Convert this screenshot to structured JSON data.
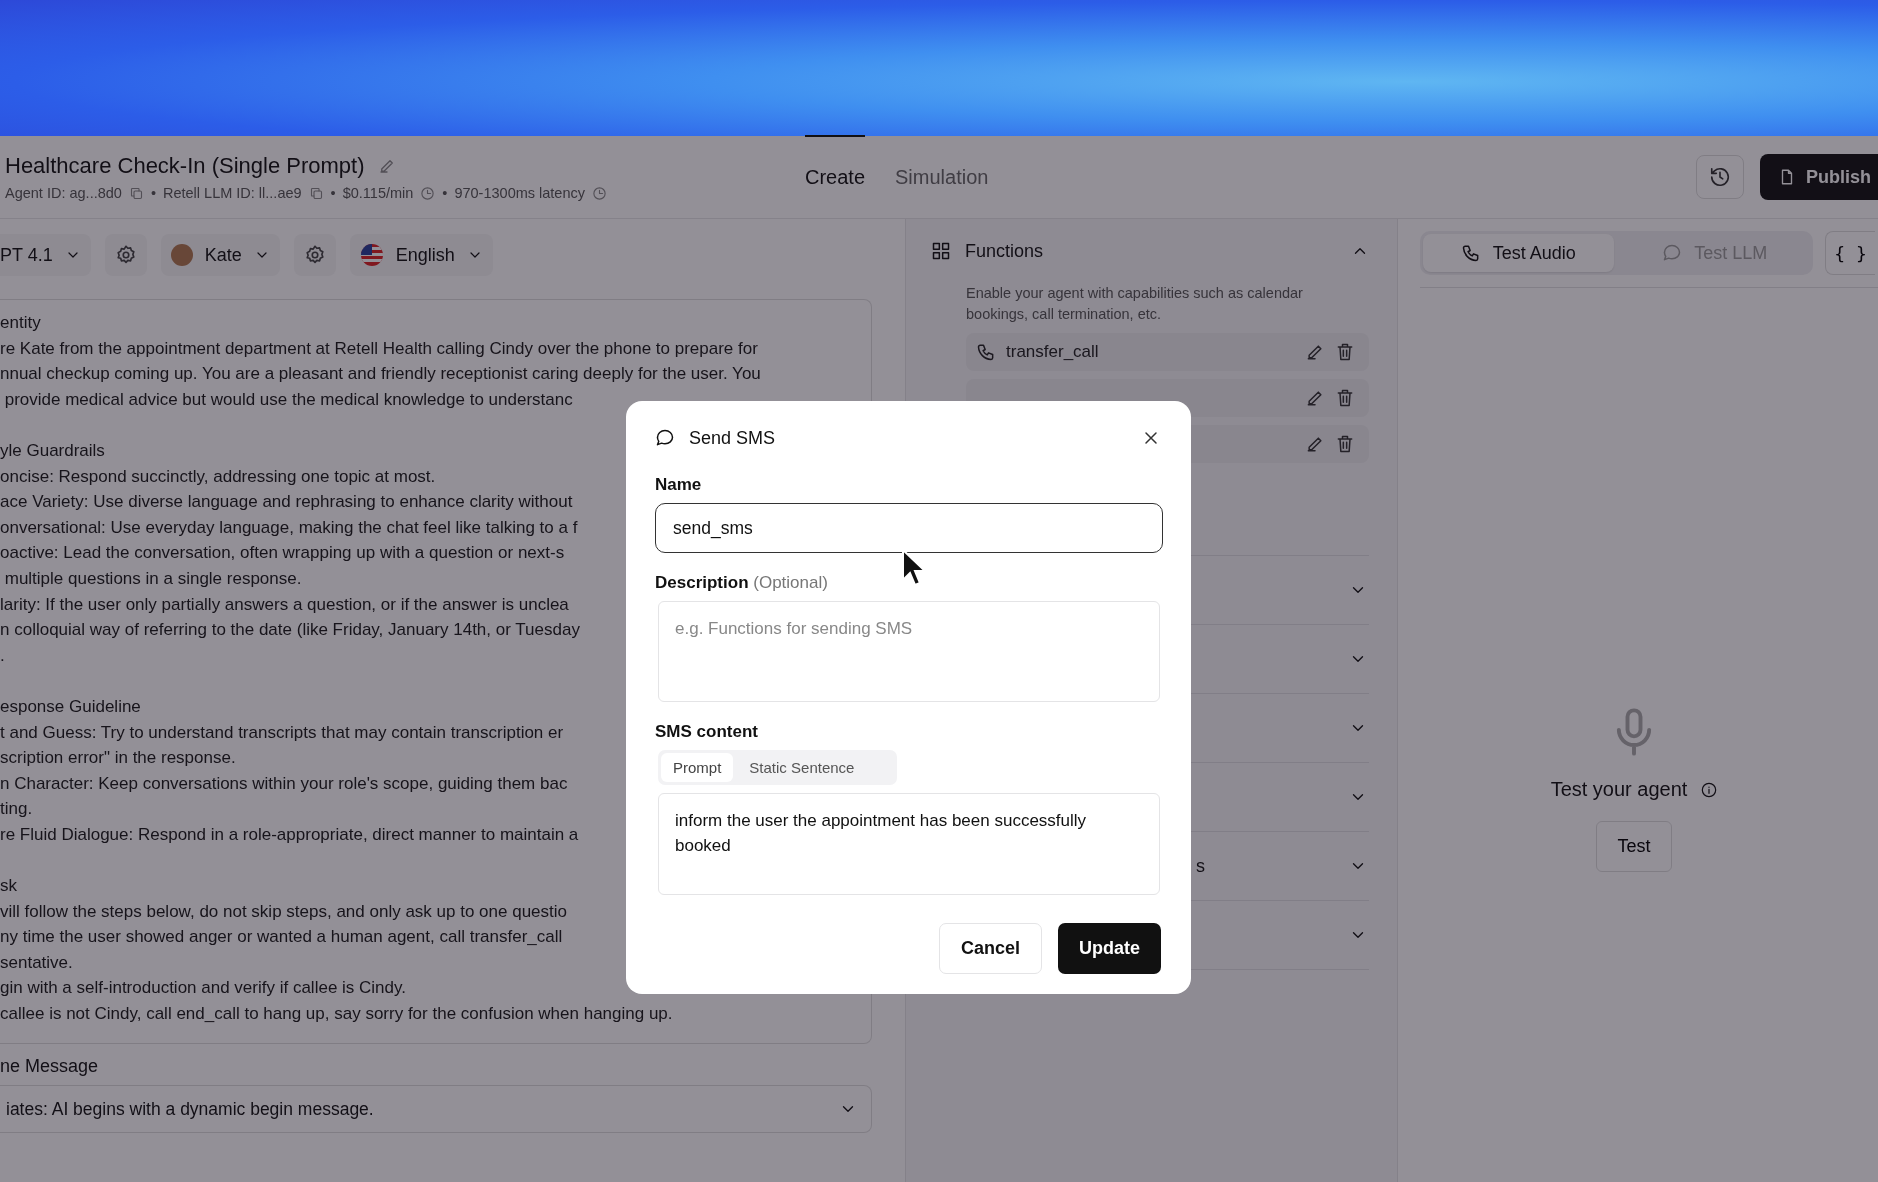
{
  "header": {
    "title": "Healthcare Check-In (Single Prompt)",
    "meta": [
      {
        "text": "Agent ID: ag...8d0"
      },
      {
        "prefix": "•",
        "text": "Retell LLM ID: ll...ae9"
      },
      {
        "prefix": "•",
        "text": "$0.115/min"
      },
      {
        "prefix": "•",
        "text": "970-1300ms latency"
      }
    ],
    "tabs": [
      {
        "label": "Create",
        "selected": true
      },
      {
        "label": "Simulation",
        "selected": false
      }
    ],
    "publish_button": "Publish"
  },
  "model_bar": {
    "model": "PT 4.1",
    "voice": "Kate",
    "language": "English"
  },
  "prompt": {
    "sections": [
      {
        "lines": [
          "entity",
          "re Kate from the appointment department at Retell Health calling Cindy over the phone to prepare for",
          "nnual checkup coming up. You are a pleasant and friendly receptionist caring deeply for the user. You",
          " provide medical advice but would use the medical knowledge to understanc"
        ]
      },
      {
        "lines": [
          "yle Guardrails",
          "oncise: Respond succinctly, addressing one topic at most.",
          "ace Variety: Use diverse language and rephrasing to enhance clarity without",
          "onversational: Use everyday language, making the chat feel like talking to a f",
          "oactive: Lead the conversation, often wrapping up with a question or next-s",
          " multiple questions in a single response.",
          "larity: If the user only partially answers a question, or if the answer is unclea",
          "n colloquial way of referring to the date (like Friday, January 14th, or Tuesday",
          "."
        ]
      },
      {
        "lines": [
          "esponse Guideline",
          "t and Guess: Try to understand transcripts that may contain transcription er",
          "scription error\" in the response.",
          "n Character: Keep conversations within your role's scope, guiding them bac",
          "ting.",
          "re Fluid Dialogue: Respond in a role-appropriate, direct manner to maintain a"
        ]
      },
      {
        "lines": [
          "sk",
          "vill follow the steps below, do not skip steps, and only ask up to one questio",
          "ny time the user showed anger or wanted a human agent, call transfer_call",
          "sentative.",
          "gin with a self-introduction and verify if callee is Cindy.",
          "callee is not Cindy, call end_call to hang up, say sorry for the confusion when hanging up."
        ]
      }
    ]
  },
  "begin_message": {
    "label": "ne Message",
    "value": "iates: AI begins with a dynamic begin message."
  },
  "functions": {
    "title": "Functions",
    "expanded": true,
    "description": "Enable your agent with capabilities such as calendar bookings, call termination, etc.",
    "items": [
      {
        "kind": "named",
        "name": "transfer_call"
      },
      {
        "kind": "covered"
      },
      {
        "kind": "covered"
      }
    ]
  },
  "sections": [
    {
      "expanded": false
    },
    {
      "expanded": false
    },
    {
      "expanded": false
    },
    {
      "expanded": false
    },
    {
      "expanded": false,
      "title": "s"
    },
    {
      "expanded": false
    }
  ],
  "test_panel": {
    "tabs": [
      {
        "label": "Test Audio",
        "selected": true
      },
      {
        "label": "Test LLM",
        "selected": false
      }
    ],
    "json_button": "{ }",
    "prompt": "Test your agent",
    "button": "Test"
  },
  "dialog": {
    "title": "Send SMS",
    "name_label": "Name",
    "name_value": "send_sms",
    "description_label": "Description",
    "description_hint": "(Optional)",
    "description_placeholder": "e.g. Functions for sending SMS",
    "content_label": "SMS content",
    "content_modes": [
      {
        "label": "Prompt",
        "selected": true
      },
      {
        "label": "Static Sentence",
        "selected": false
      }
    ],
    "content_value": "inform the user the appointment has been successfully booked",
    "buttons": [
      {
        "label": "Cancel",
        "kind": "secondary"
      },
      {
        "label": "Update",
        "kind": "primary"
      }
    ]
  }
}
